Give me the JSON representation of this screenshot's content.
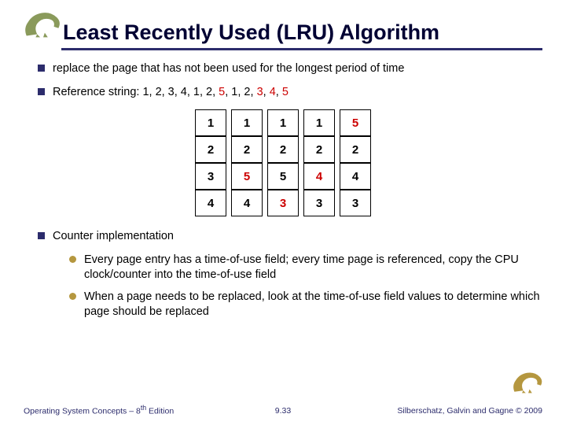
{
  "title": "Least Recently Used (LRU) Algorithm",
  "bullets": {
    "b1": "replace the page that has not been used for the longest period of time",
    "b2_prefix": "Reference string:  1, 2, 3, 4, 1, 2, ",
    "b2_r1": "5",
    "b2_mid1": ", 1, 2, ",
    "b2_r2": "3",
    "b2_mid2": ", ",
    "b2_r3": "4",
    "b2_mid3": ", ",
    "b2_r4": "5",
    "b3": "Counter implementation",
    "b3a": "Every page entry has a time-of-use field; every time page is referenced, copy the CPU clock/counter into the time-of-use field",
    "b3b": "When a page needs to be replaced, look at the time-of-use field values to determine which page should be replaced"
  },
  "table": {
    "rows": [
      [
        {
          "v": "1",
          "c": "#000"
        },
        {
          "v": "1",
          "c": "#000"
        },
        {
          "v": "1",
          "c": "#000"
        },
        {
          "v": "1",
          "c": "#000"
        },
        {
          "v": "5",
          "c": "#cc0000"
        }
      ],
      [
        {
          "v": "2",
          "c": "#000"
        },
        {
          "v": "2",
          "c": "#000"
        },
        {
          "v": "2",
          "c": "#000"
        },
        {
          "v": "2",
          "c": "#000"
        },
        {
          "v": "2",
          "c": "#000"
        }
      ],
      [
        {
          "v": "3",
          "c": "#000"
        },
        {
          "v": "5",
          "c": "#cc0000"
        },
        {
          "v": "5",
          "c": "#000"
        },
        {
          "v": "4",
          "c": "#cc0000"
        },
        {
          "v": "4",
          "c": "#000"
        }
      ],
      [
        {
          "v": "4",
          "c": "#000"
        },
        {
          "v": "4",
          "c": "#000"
        },
        {
          "v": "3",
          "c": "#cc0000"
        },
        {
          "v": "3",
          "c": "#000"
        },
        {
          "v": "3",
          "c": "#000"
        }
      ]
    ]
  },
  "footer": {
    "left_a": "Operating System Concepts – 8",
    "left_sup": "th",
    "left_b": " Edition",
    "mid": "9.33",
    "right": "Silberschatz, Galvin and Gagne © 2009"
  }
}
